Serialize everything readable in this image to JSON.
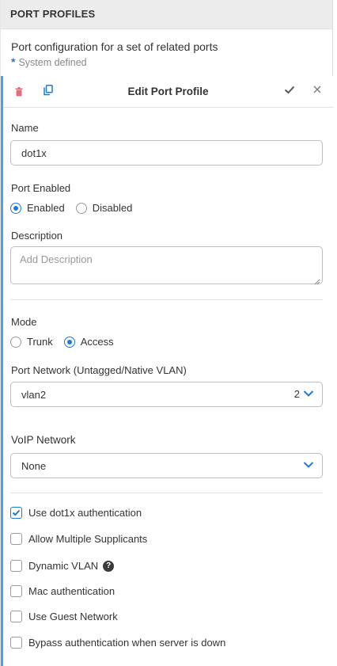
{
  "header": {
    "title": "PORT PROFILES"
  },
  "intro": {
    "description": "Port configuration for a set of related ports",
    "system_defined_star": "*",
    "system_defined": "System defined"
  },
  "editor": {
    "title": "Edit Port Profile",
    "icons": {
      "delete": "trash-icon",
      "copy": "copy-icon",
      "save": "check-icon",
      "close": "close-icon"
    },
    "name": {
      "label": "Name",
      "value": "dot1x"
    },
    "port_enabled": {
      "label": "Port Enabled",
      "options": [
        "Enabled",
        "Disabled"
      ],
      "selected": "Enabled"
    },
    "description": {
      "label": "Description",
      "placeholder": "Add Description",
      "value": ""
    },
    "mode": {
      "label": "Mode",
      "options": [
        "Trunk",
        "Access"
      ],
      "selected": "Access"
    },
    "port_network": {
      "label": "Port Network (Untagged/Native VLAN)",
      "value": "vlan2",
      "vlan_id": "2"
    },
    "voip_network": {
      "label": "VoIP Network",
      "value": "None"
    },
    "checkboxes": [
      {
        "label": "Use dot1x authentication",
        "checked": true
      },
      {
        "label": "Allow Multiple Supplicants",
        "checked": false
      },
      {
        "label": "Dynamic VLAN",
        "checked": false,
        "help": true
      },
      {
        "label": "Mac authentication",
        "checked": false
      },
      {
        "label": "Use Guest Network",
        "checked": false
      },
      {
        "label": "Bypass authentication when server is down",
        "checked": false
      }
    ],
    "help_glyph": "?"
  },
  "colors": {
    "accent": "#1f7ad1",
    "edit_border": "#4aa3df",
    "danger": "#e0707a",
    "header_bg": "#ececec"
  }
}
